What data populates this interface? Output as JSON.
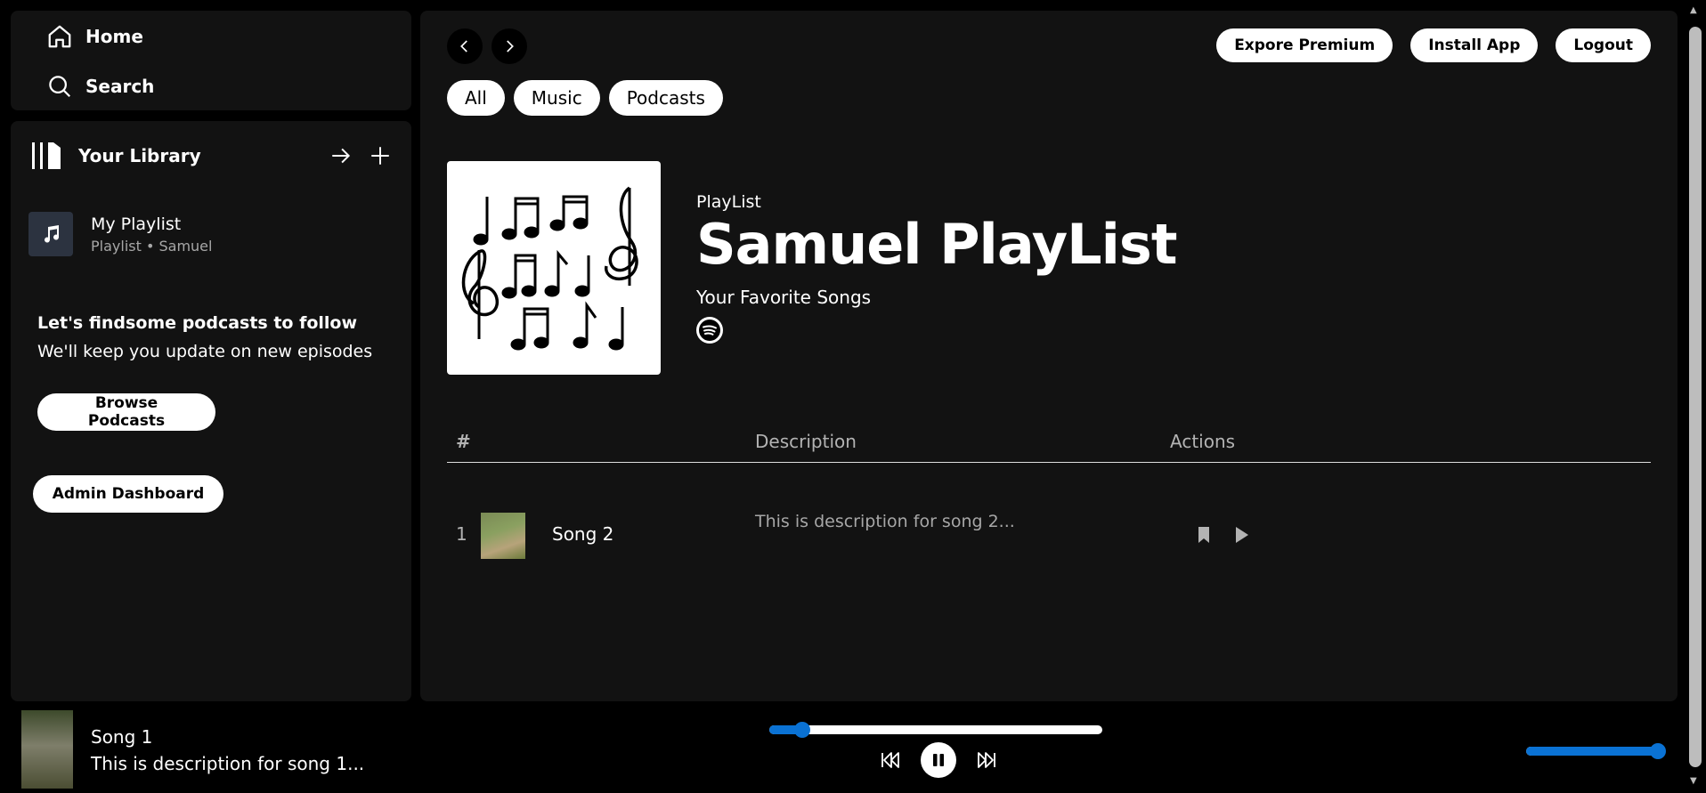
{
  "nav": {
    "home": "Home",
    "search": "Search"
  },
  "library": {
    "title": "Your Library",
    "playlist": {
      "name": "My Playlist",
      "subtitle": "Playlist • Samuel"
    },
    "podcasts": {
      "title": "Let's findsome podcasts to follow",
      "text": "We'll keep you update on new episodes",
      "browse_label": "Browse Podcasts"
    },
    "admin_label": "Admin Dashboard"
  },
  "header": {
    "premium_label": "Expore Premium",
    "install_label": "Install App",
    "logout_label": "Logout"
  },
  "filters": [
    "All",
    "Music",
    "Podcasts"
  ],
  "playlist": {
    "type": "PlayList",
    "title": "Samuel PlayList",
    "description": "Your Favorite Songs"
  },
  "table": {
    "columns": [
      "#",
      "Description",
      "Actions"
    ],
    "rows": [
      {
        "num": "1",
        "title": "Song 2",
        "description": "This is description for song 2..."
      }
    ]
  },
  "player": {
    "title": "Song 1",
    "description": "This is description for song 1...",
    "progress": 0.1,
    "volume": 1.0
  },
  "colors": {
    "accent": "#0a72d4",
    "panel": "#121212",
    "background": "#000000"
  }
}
